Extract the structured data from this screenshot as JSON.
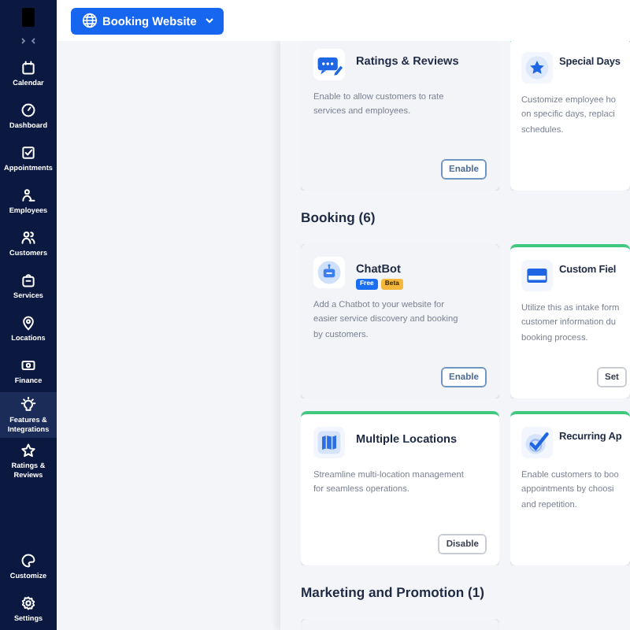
{
  "sidebar": {
    "items": [
      {
        "label": "Calendar",
        "selected": false
      },
      {
        "label": "Dashboard",
        "selected": false
      },
      {
        "label": "Appointments",
        "selected": false
      },
      {
        "label": "Employees",
        "selected": false
      },
      {
        "label": "Customers",
        "selected": false
      },
      {
        "label": "Services",
        "selected": false
      },
      {
        "label": "Locations",
        "selected": false
      },
      {
        "label": "Finance",
        "selected": false
      },
      {
        "label": "Features & Integrations",
        "selected": true
      },
      {
        "label": "Ratings & Reviews",
        "selected": false
      }
    ],
    "bottom_items": [
      {
        "label": "Customize",
        "selected": false
      },
      {
        "label": "Settings",
        "selected": false
      }
    ]
  },
  "topbar": {
    "site_button": "Booking Website"
  },
  "sections": [
    {
      "cards": [
        {
          "title": "Ratings & Reviews",
          "description_lines": [
            "Enable to allow customers to rate",
            "services and employees."
          ],
          "enabled": false,
          "button": "Enable"
        },
        {
          "title": "Special Days",
          "description_lines": [
            "Customize employee ho",
            "on specific days, replaci",
            "schedules."
          ],
          "enabled": true
        }
      ]
    },
    {
      "heading": "Booking (6)",
      "cards": [
        {
          "title": "ChatBot",
          "badges": [
            {
              "label": "Free",
              "color": "#1b6ef3"
            },
            {
              "label": "Beta",
              "color": "#f5b83d"
            }
          ],
          "description_lines": [
            "Add a Chatbot to your website for",
            "easier service discovery and booking",
            "by customers."
          ],
          "enabled": false,
          "button": "Enable"
        },
        {
          "title": "Custom Fiel",
          "description_lines": [
            "Utilize this as intake form",
            "customer information du",
            "booking process."
          ],
          "enabled": true,
          "button": "Set"
        },
        {
          "title": "Multiple Locations",
          "description_lines": [
            "Streamline multi-location management",
            "for seamless operations."
          ],
          "enabled": true,
          "button": "Disable"
        },
        {
          "title": "Recurring Ap",
          "description_lines": [
            "Enable customers to boo",
            "appointments by choosi",
            "and repetition."
          ],
          "enabled": true
        }
      ]
    },
    {
      "heading": "Marketing and Promotion (1)",
      "cards": [
        {
          "enabled": false
        }
      ]
    }
  ]
}
